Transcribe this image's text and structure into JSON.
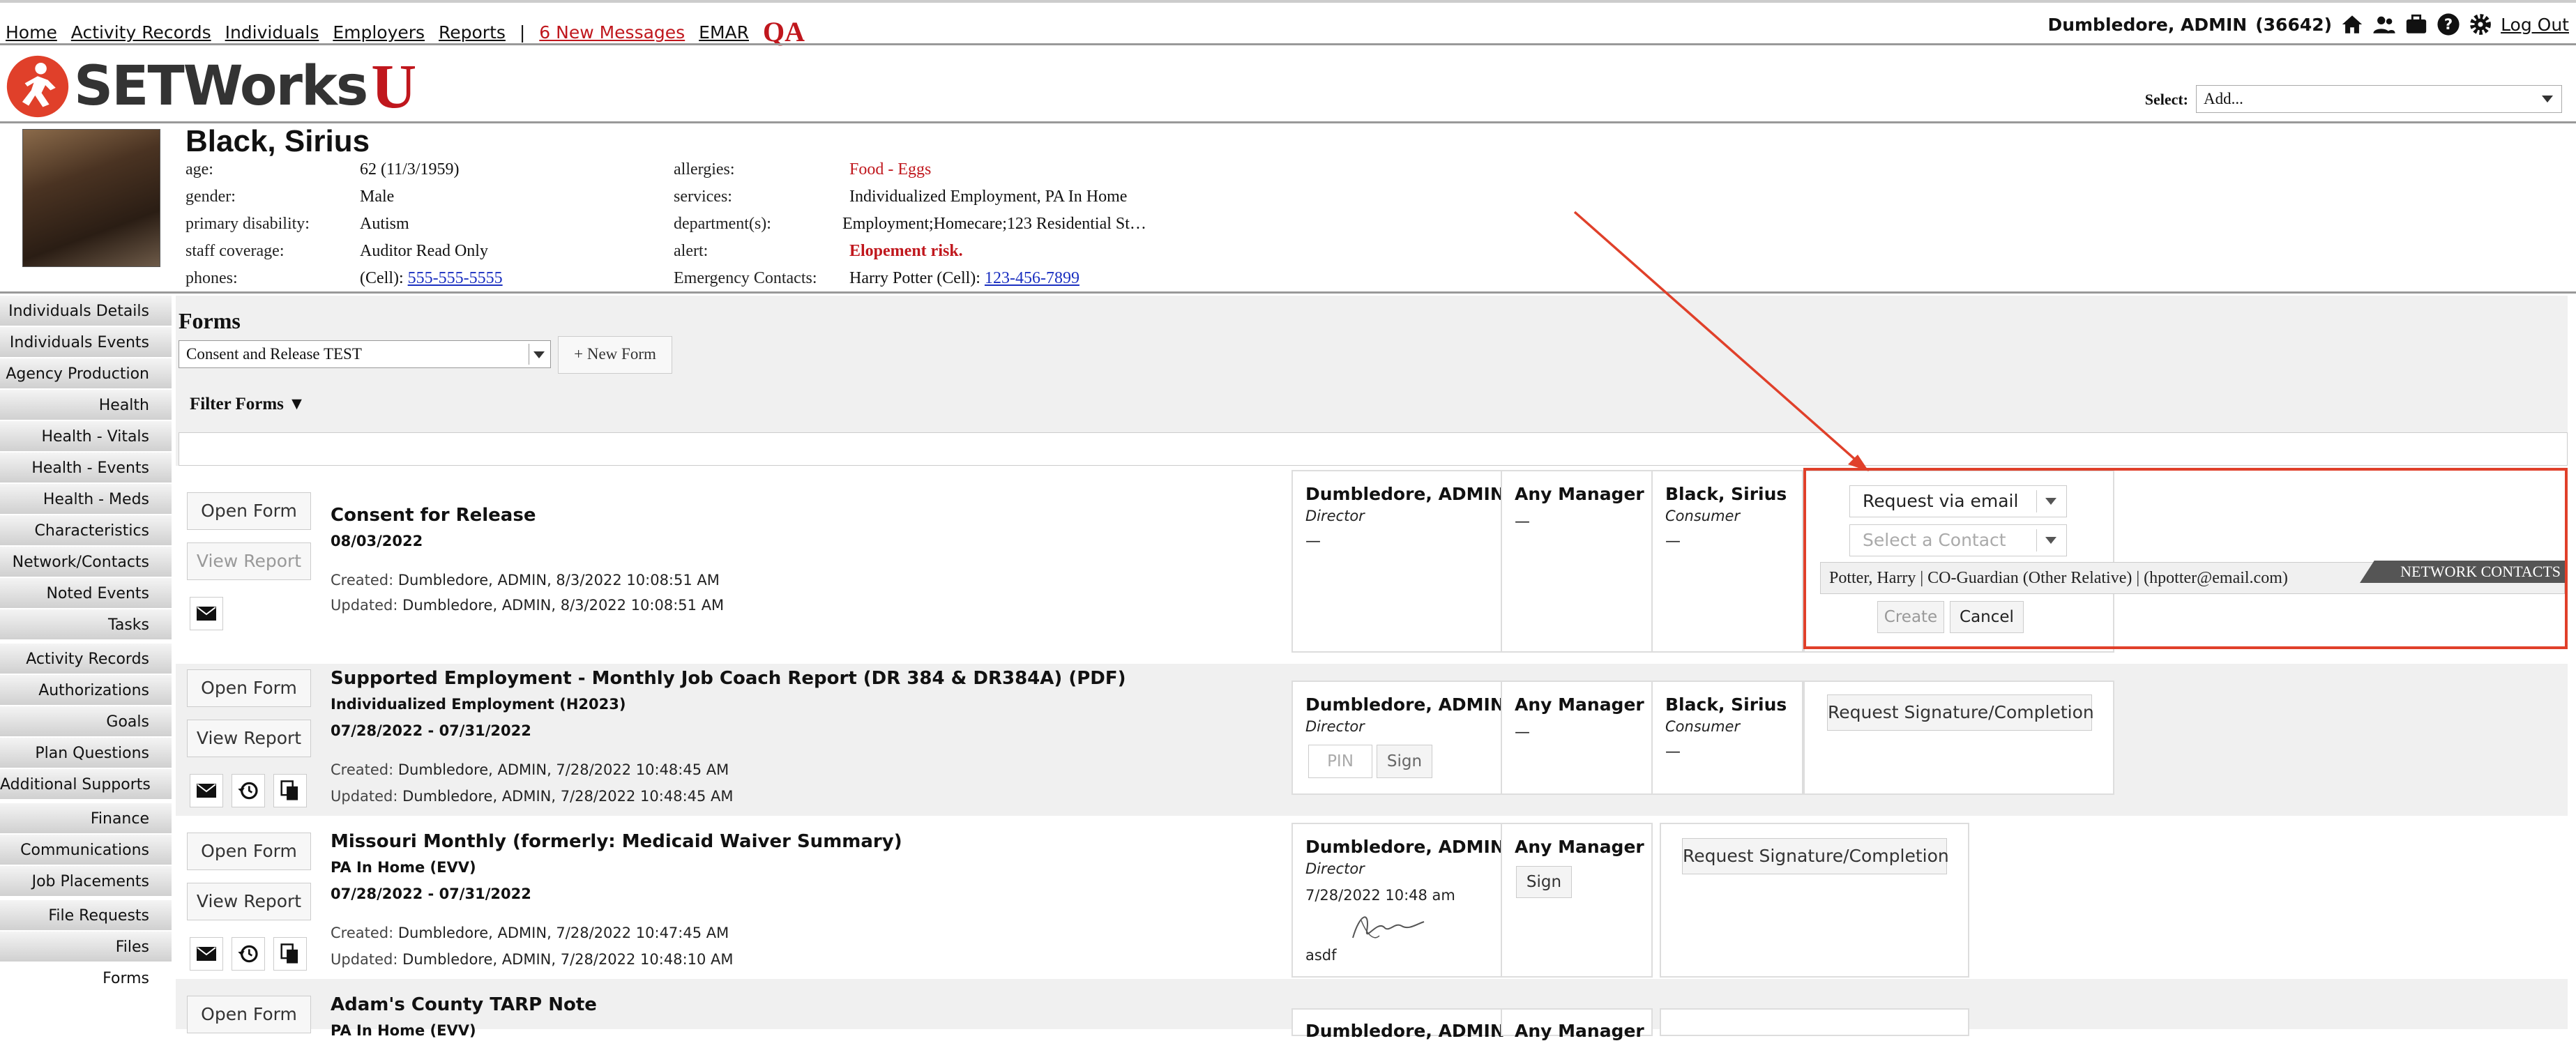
{
  "nav": {
    "home": "Home",
    "activity_records": "Activity Records",
    "individuals": "Individuals",
    "employers": "Employers",
    "reports": "Reports",
    "separator": "|",
    "messages": "6 New Messages",
    "emar": "EMAR",
    "qa": "QA"
  },
  "user": {
    "name": "Dumbledore, ADMIN",
    "id": "(36642)",
    "logout": "Log Out"
  },
  "logo": {
    "text": "SETWorks",
    "suffix": "U"
  },
  "select_add": {
    "label": "Select:",
    "value": "Add..."
  },
  "individual": {
    "name": "Black, Sirius",
    "fields_left": [
      {
        "label": "age:",
        "value": "62 (11/3/1959)"
      },
      {
        "label": "gender:",
        "value": "Male"
      },
      {
        "label": "primary disability:",
        "value": "Autism"
      },
      {
        "label": "staff coverage:",
        "value": "Auditor Read Only"
      },
      {
        "label": "phones:",
        "prefix": "(Cell):",
        "value": "555-555-5555"
      }
    ],
    "fields_right": [
      {
        "label": "allergies:",
        "value": "Food - Eggs"
      },
      {
        "label": "services:",
        "value": "Individualized Employment, PA In Home"
      },
      {
        "label": "department(s):",
        "value": "Employment;Homecare;123 Residential St…"
      },
      {
        "label": "alert:",
        "value": "Elopement risk."
      },
      {
        "label": "Emergency Contacts:",
        "prefix": "Harry Potter (Cell):",
        "value": "123-456-7899"
      }
    ]
  },
  "sidebar": {
    "items": [
      {
        "label": "Individuals Details"
      },
      {
        "label": "Individuals Events"
      },
      {
        "label": "Agency Production"
      },
      {
        "label": "Health"
      },
      {
        "label": "Health - Vitals"
      },
      {
        "label": "Health - Events"
      },
      {
        "label": "Health - Meds"
      },
      {
        "label": "Characteristics"
      },
      {
        "label": "Network/Contacts"
      },
      {
        "label": "Noted Events"
      },
      {
        "label": "Tasks"
      },
      {
        "label": "Activity Records"
      },
      {
        "label": "Authorizations"
      },
      {
        "label": "Goals"
      },
      {
        "label": "Plan Questions"
      },
      {
        "label": "Additional Supports"
      },
      {
        "label": "Finance"
      },
      {
        "label": "Communications"
      },
      {
        "label": "Job Placements"
      },
      {
        "label": "File Requests"
      },
      {
        "label": "Files"
      },
      {
        "label": "Forms"
      }
    ]
  },
  "forms": {
    "title": "Forms",
    "select_value": "Consent and Release TEST",
    "new_form": "+ New Form",
    "filter": "Filter Forms ▼"
  },
  "rows": [
    {
      "title": "Consent for Release",
      "subtitle": "",
      "date": "08/03/2022",
      "created_label": "Created:",
      "created": "Dumbledore, ADMIN, 8/3/2022 10:08:51 AM",
      "updated_label": "Updated:",
      "updated": "Dumbledore, ADMIN, 8/3/2022 10:08:51 AM",
      "open": "Open Form",
      "view": "View Report",
      "sig1": {
        "name": "Dumbledore, ADMIN",
        "role": "Director",
        "status": "—"
      },
      "sig2": {
        "name": "Any Manager",
        "status": "—"
      },
      "sig3": {
        "name": "Black, Sirius",
        "role": "Consumer",
        "status": "—"
      },
      "request": {
        "method": "Request via email",
        "contact_placeholder": "Select a Contact",
        "contact_option": "Potter, Harry | CO-Guardian (Other Relative) | (hpotter@email.com)",
        "network_tag": "NETWORK CONTACTS",
        "create": "Create",
        "cancel": "Cancel"
      }
    },
    {
      "title": "Supported Employment - Monthly Job Coach Report (DR 384 & DR384A) (PDF)",
      "subtitle": "Individualized Employment (H2023)",
      "date": "07/28/2022 - 07/31/2022",
      "created_label": "Created:",
      "created": "Dumbledore, ADMIN, 7/28/2022 10:48:45 AM",
      "updated_label": "Updated:",
      "updated": "Dumbledore, ADMIN, 7/28/2022 10:48:45 AM",
      "open": "Open Form",
      "view": "View Report",
      "sig1": {
        "name": "Dumbledore, ADMIN",
        "role": "Director",
        "pin": "PIN",
        "sign": "Sign"
      },
      "sig2": {
        "name": "Any Manager",
        "status": "—"
      },
      "sig3": {
        "name": "Black, Sirius",
        "role": "Consumer",
        "status": "—"
      },
      "request_btn": "Request Signature/Completion"
    },
    {
      "title": "Missouri Monthly (formerly: Medicaid Waiver Summary)",
      "subtitle": "PA In Home (EVV)",
      "date": "07/28/2022 - 07/31/2022",
      "created_label": "Created:",
      "created": "Dumbledore, ADMIN, 7/28/2022 10:47:45 AM",
      "updated_label": "Updated:",
      "updated": "Dumbledore, ADMIN, 7/28/2022 10:48:10 AM",
      "open": "Open Form",
      "view": "View Report",
      "sig1": {
        "name": "Dumbledore, ADMIN",
        "role": "Director",
        "signed_at": "7/28/2022 10:48 am",
        "signed_text": "asdf"
      },
      "sig2": {
        "name": "Any Manager",
        "sign": "Sign"
      },
      "request_btn": "Request Signature/Completion"
    },
    {
      "title": "Adam's County TARP Note",
      "subtitle": "PA In Home (EVV)",
      "open": "Open Form",
      "sig1": {
        "name": "Dumbledore, ADMIN"
      },
      "sig2": {
        "name": "Any Manager"
      }
    }
  ]
}
